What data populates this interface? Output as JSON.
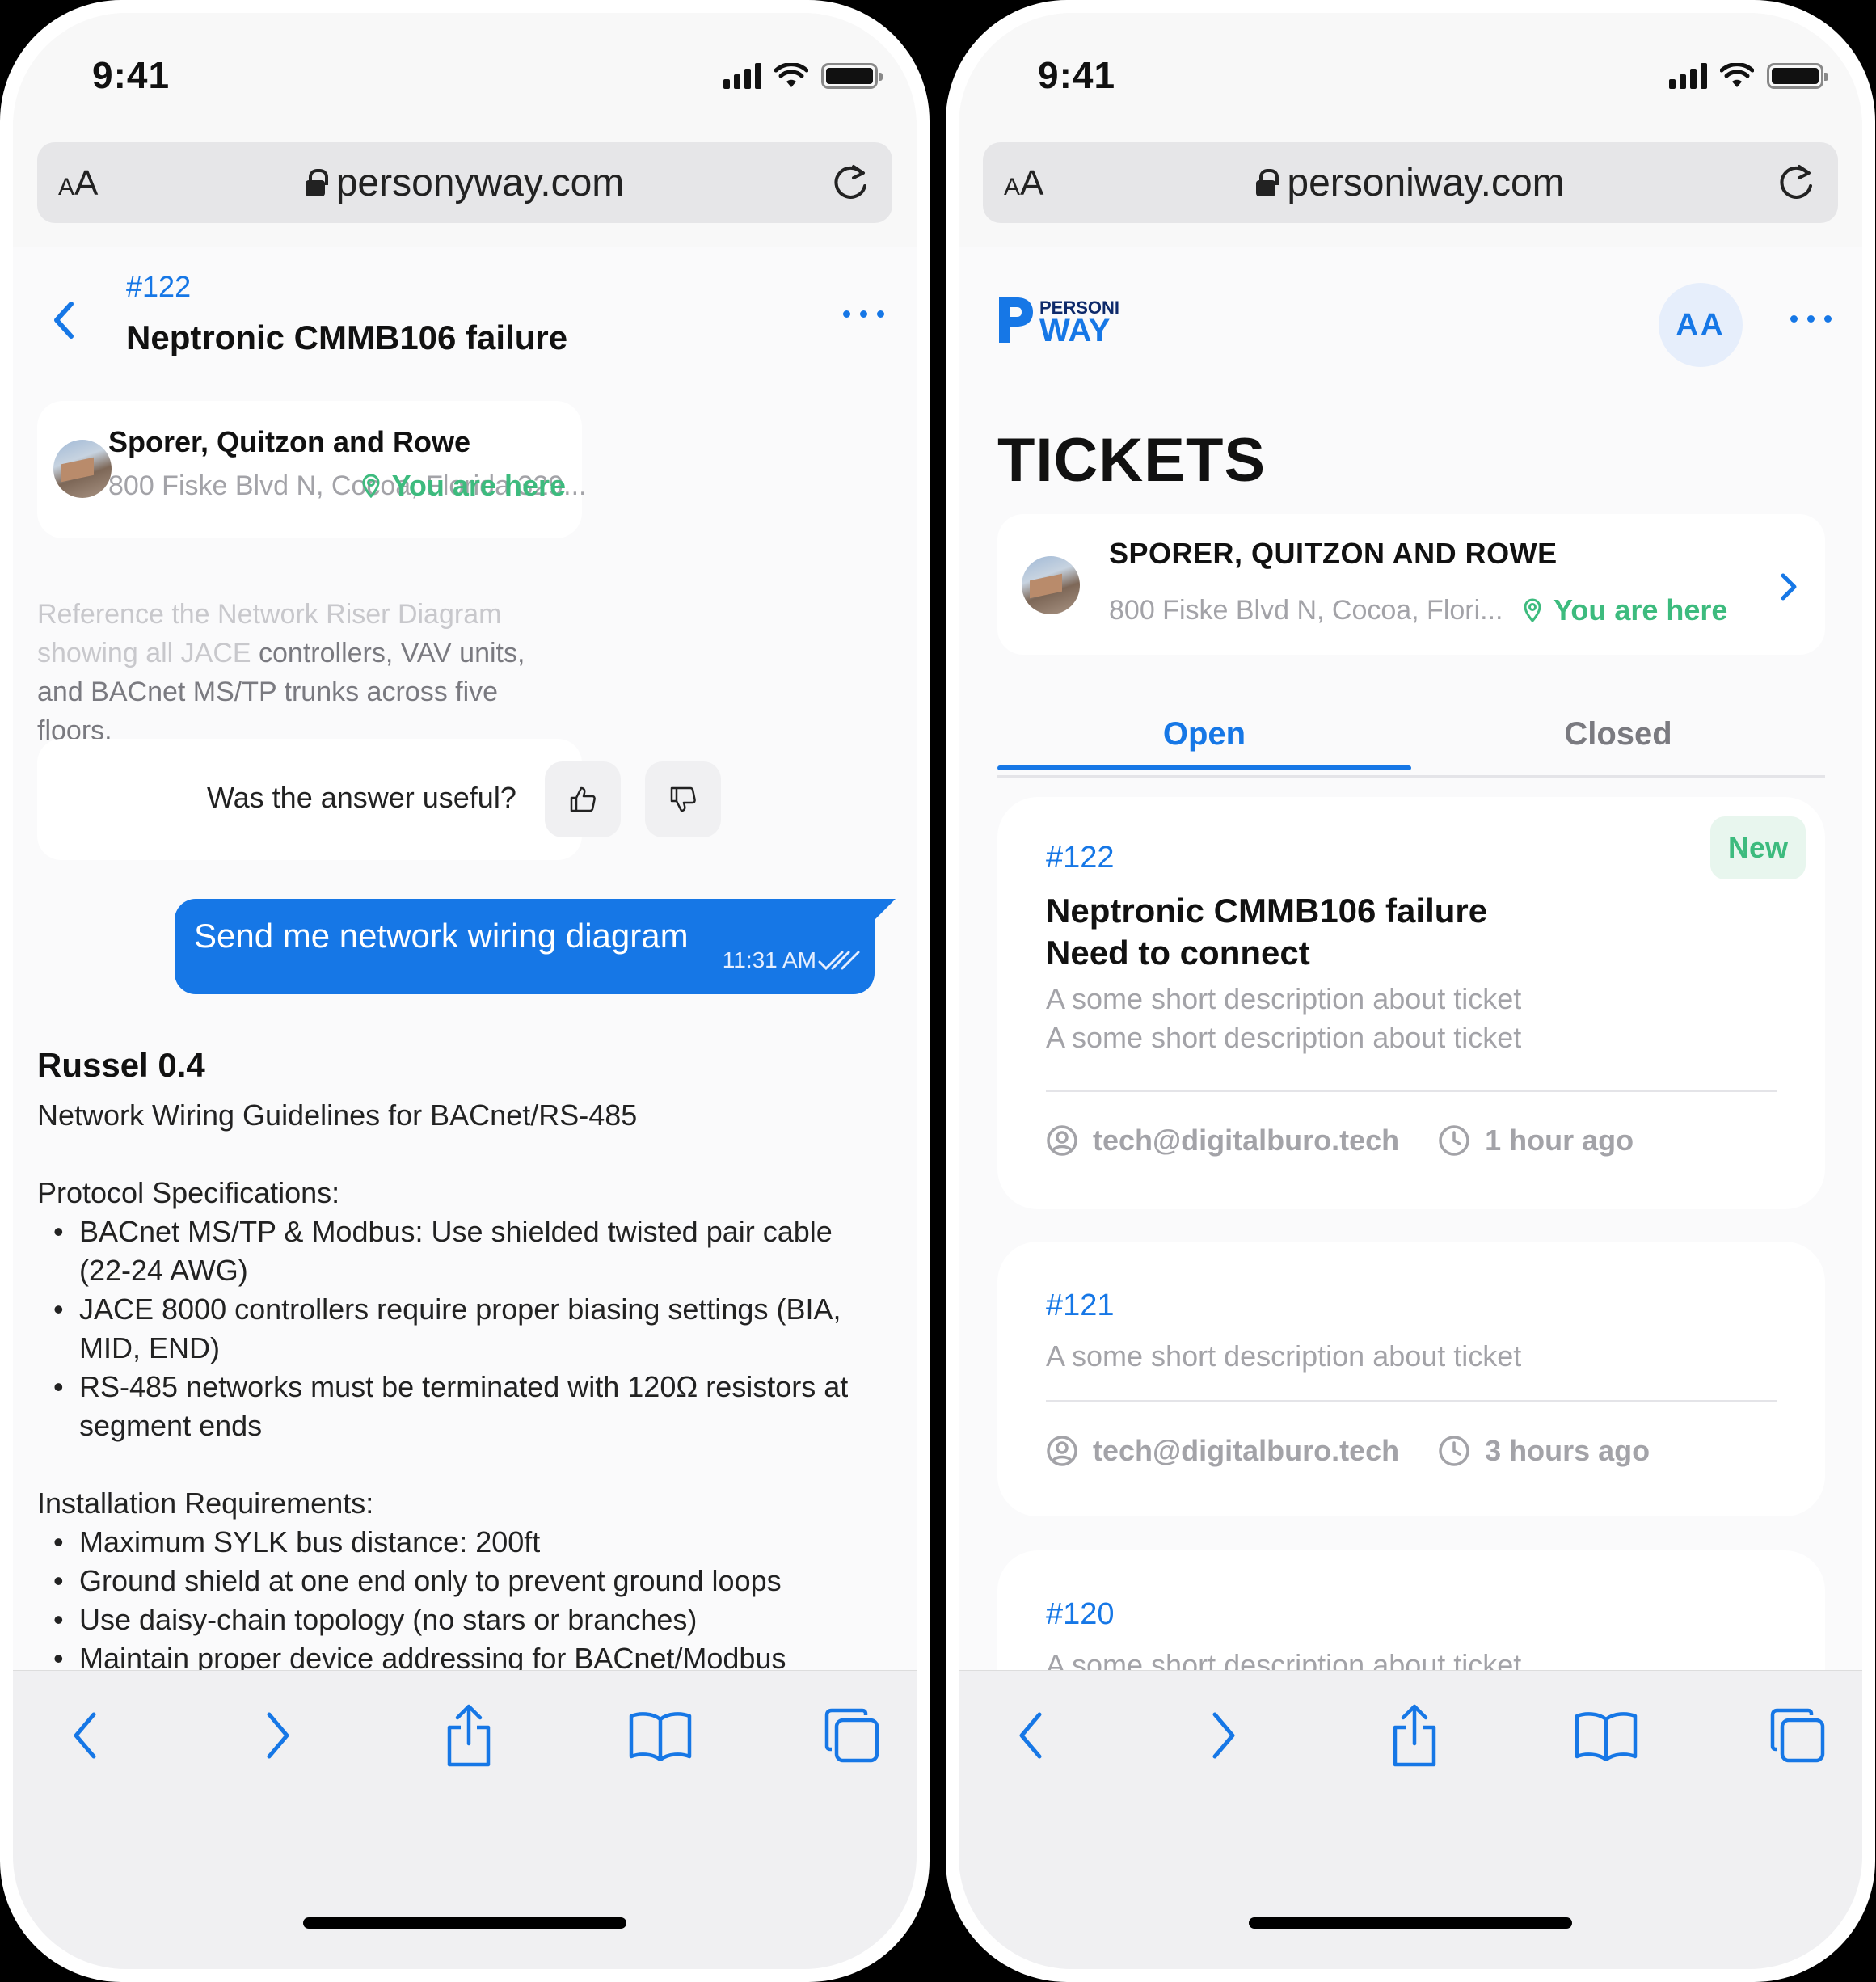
{
  "status_bar": {
    "time": "9:41"
  },
  "left": {
    "browser": {
      "aa_small": "A",
      "aa_big": "A",
      "url": "personyway.com"
    },
    "header": {
      "ticket_number": "#122",
      "title": "Neptronic CMMB106 failure"
    },
    "location": {
      "name": "Sporer, Quitzon and Rowe",
      "address": "800 Fiske Blvd N, Cocoa, Florida 329...",
      "here": "You are here"
    },
    "description": {
      "faded": "Reference the Network Riser Diagram showing all JACE",
      "rest": "controllers, VAV units, and BACnet MS/TP trunks across five floors."
    },
    "feedback": {
      "question": "Was the answer useful?"
    },
    "message": {
      "text": "Send me network wiring diagram",
      "time": "11:31 AM"
    },
    "reply": {
      "author": "Russel 0.4",
      "heading": "Network Wiring Guidelines for BACnet/RS-485",
      "section1": "Protocol Specifications:",
      "items1": [
        "BACnet MS/TP & Modbus: Use shielded twisted pair cable (22-24 AWG)",
        "JACE 8000 controllers require proper biasing settings (BIA, MID, END)",
        "RS-485 networks must be terminated with 120Ω resistors at segment ends"
      ],
      "section2": "Installation Requirements:",
      "items2": [
        "Maximum SYLK bus distance: 200ft",
        "Ground shield at one end only to prevent ground loops",
        "Use daisy-chain topology (no stars or branches)",
        "Maintain proper device addressing for BACnet/Modbus networks"
      ]
    }
  },
  "right": {
    "browser": {
      "aa_small": "A",
      "aa_big": "A",
      "url": "personiway.com"
    },
    "logo": {
      "top": "PERSONI",
      "bottom": "WAY"
    },
    "avatar": "AA",
    "page_title": "TICKETS",
    "location": {
      "name": "SPORER, QUITZON AND ROWE",
      "address": "800 Fiske Blvd N, Cocoa, Flori...",
      "here": "You are here"
    },
    "tabs": {
      "open": "Open",
      "closed": "Closed"
    },
    "tickets": [
      {
        "number": "#122",
        "badge": "New",
        "title_line1": "Neptronic CMMB106 failure",
        "title_line2": "Need to connect",
        "desc_line1": "A some short description about ticket",
        "desc_line2": "A some short description about ticket",
        "email": "tech@digitalburo.tech",
        "time": "1 hour ago"
      },
      {
        "number": "#121",
        "desc_line1": "A some short description about ticket",
        "email": "tech@digitalburo.tech",
        "time": "3 hours ago"
      },
      {
        "number": "#120",
        "desc_line1": "A some short description about ticket"
      }
    ]
  },
  "colors": {
    "accent": "#1677e6",
    "success": "#3dbb7e",
    "muted": "#a3a3a8"
  },
  "icons": [
    "back-chevron-icon",
    "more-dots-icon",
    "location-pin-icon",
    "thumbs-up-icon",
    "thumbs-down-icon",
    "double-check-icon",
    "chevron-right-icon",
    "user-circle-icon",
    "clock-icon",
    "lock-icon",
    "reload-icon",
    "share-icon",
    "bookmarks-icon",
    "tabs-icon"
  ]
}
